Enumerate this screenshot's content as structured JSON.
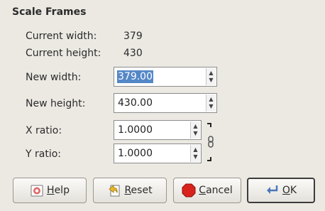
{
  "dialog": {
    "title": "Scale Frames"
  },
  "info": {
    "current_width_label": "Current width:",
    "current_width_value": "379",
    "current_height_label": "Current height:",
    "current_height_value": "430"
  },
  "fields": {
    "new_width": {
      "label": "New width:",
      "value": "379.00"
    },
    "new_height": {
      "label": "New height:",
      "value": "430.00"
    },
    "x_ratio": {
      "label": "X ratio:",
      "value": "1.0000"
    },
    "y_ratio": {
      "label": "Y ratio:",
      "value": "1.0000"
    }
  },
  "buttons": {
    "help": {
      "mnemonic": "H",
      "rest": "elp",
      "icon": "help-icon"
    },
    "reset": {
      "mnemonic": "R",
      "rest": "eset",
      "icon": "reset-icon"
    },
    "cancel": {
      "mnemonic": "C",
      "rest": "ancel",
      "icon": "cancel-icon"
    },
    "ok": {
      "mnemonic": "O",
      "rest": "K",
      "icon": "ok-icon"
    }
  },
  "colors": {
    "selection": "#5487c7",
    "cancel_red": "#d9221c",
    "background": "#ece9e3"
  }
}
